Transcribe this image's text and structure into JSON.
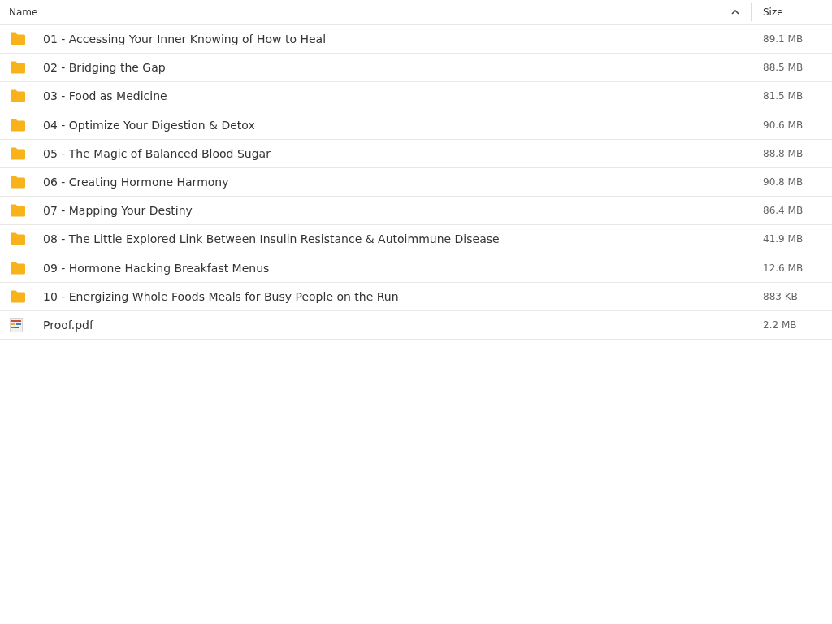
{
  "columns": [
    {
      "label": "Name"
    },
    {
      "label": "Size"
    }
  ],
  "rows": [
    {
      "kind": "folder",
      "name": "01 - Accessing Your Inner Knowing of How to Heal",
      "size": "89.1 MB"
    },
    {
      "kind": "folder",
      "name": "02 - Bridging the Gap",
      "size": "88.5 MB"
    },
    {
      "kind": "folder",
      "name": "03 - Food as Medicine",
      "size": "81.5 MB"
    },
    {
      "kind": "folder",
      "name": "04 - Optimize Your Digestion & Detox",
      "size": "90.6 MB"
    },
    {
      "kind": "folder",
      "name": "05 - The Magic of Balanced Blood Sugar",
      "size": "88.8 MB"
    },
    {
      "kind": "folder",
      "name": "06 - Creating Hormone Harmony",
      "size": "90.8 MB"
    },
    {
      "kind": "folder",
      "name": "07 - Mapping Your Destiny",
      "size": "86.4 MB"
    },
    {
      "kind": "folder",
      "name": "08 - The Little Explored Link Between Insulin Resistance & Autoimmune Disease",
      "size": "41.9 MB"
    },
    {
      "kind": "folder",
      "name": "09 - Hormone Hacking Breakfast Menus",
      "size": "12.6 MB"
    },
    {
      "kind": "folder",
      "name": "10 - Energizing Whole Foods Meals for Busy People on the Run",
      "size": "883 KB"
    },
    {
      "kind": "pdf",
      "name": "Proof.pdf",
      "size": "2.2 MB"
    }
  ]
}
